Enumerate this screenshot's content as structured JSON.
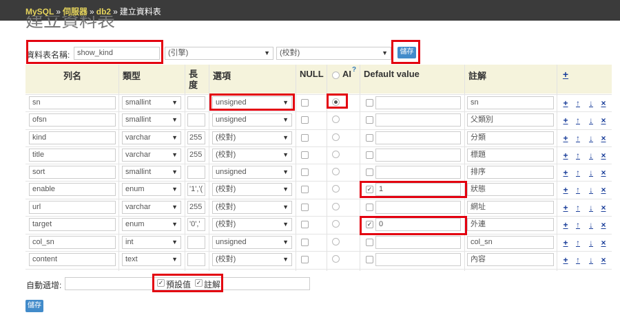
{
  "breadcrumb": {
    "app": "MySQL",
    "server": "伺服器",
    "db": "db2",
    "current": "建立資料表",
    "separator": "»"
  },
  "page_title": "建立資料表",
  "table_form": {
    "name_label": "資料表名稱:",
    "name_value": "show_kind",
    "engine": "(引擎)",
    "collation": "(校對)",
    "save_label": "儲存"
  },
  "columns_header": {
    "name": "列名",
    "type": "類型",
    "length": "長度",
    "options": "選項",
    "null": "NULL",
    "ai": "AI",
    "ai_help": "?",
    "default": "Default value",
    "comment": "註解",
    "add": "+"
  },
  "rows": [
    {
      "name": "sn",
      "type": "smallint",
      "length": "",
      "options": "unsigned",
      "ai": true,
      "default_checked": false,
      "default": "",
      "comment": "sn"
    },
    {
      "name": "ofsn",
      "type": "smallint",
      "length": "",
      "options": "unsigned",
      "ai": false,
      "default_checked": false,
      "default": "",
      "comment": "父類別"
    },
    {
      "name": "kind",
      "type": "varchar",
      "length": "255",
      "options": "(校對)",
      "ai": false,
      "default_checked": false,
      "default": "",
      "comment": "分類"
    },
    {
      "name": "title",
      "type": "varchar",
      "length": "255",
      "options": "(校對)",
      "ai": false,
      "default_checked": false,
      "default": "",
      "comment": "標題"
    },
    {
      "name": "sort",
      "type": "smallint",
      "length": "",
      "options": "unsigned",
      "ai": false,
      "default_checked": false,
      "default": "",
      "comment": "排序"
    },
    {
      "name": "enable",
      "type": "enum",
      "length": "'1','(",
      "options": "(校對)",
      "ai": false,
      "default_checked": true,
      "default": "1",
      "comment": "狀態"
    },
    {
      "name": "url",
      "type": "varchar",
      "length": "255",
      "options": "(校對)",
      "ai": false,
      "default_checked": false,
      "default": "",
      "comment": "網址"
    },
    {
      "name": "target",
      "type": "enum",
      "length": "'0','",
      "options": "(校對)",
      "ai": false,
      "default_checked": true,
      "default": "0",
      "comment": "外連"
    },
    {
      "name": "col_sn",
      "type": "int",
      "length": "",
      "options": "unsigned",
      "ai": false,
      "default_checked": false,
      "default": "",
      "comment": "col_sn"
    },
    {
      "name": "content",
      "type": "text",
      "length": "",
      "options": "(校對)",
      "ai": false,
      "default_checked": false,
      "default": "",
      "comment": "內容"
    }
  ],
  "row_actions": {
    "add": "+",
    "up": "↑",
    "down": "↓",
    "remove": "×"
  },
  "footer": {
    "auto_increment_label": "自動遞增:",
    "default_values_label": "預設值",
    "comments_label": "註解",
    "save_label": "儲存"
  },
  "colors": {
    "highlight": "#e3000f",
    "header_bg": "#f5f3dc",
    "topbar": "#3b3b3b",
    "link": "#e6d45c",
    "button": "#428bca"
  }
}
